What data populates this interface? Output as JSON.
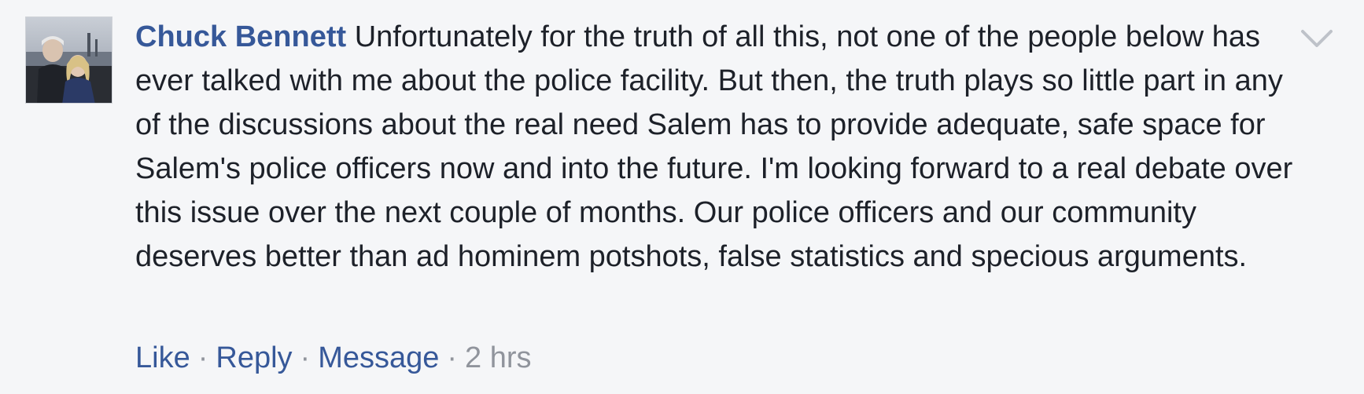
{
  "comment": {
    "author": "Chuck Bennett",
    "text": "Unfortunately for the truth of all this, not one of the people below has ever talked with me about the police facility. But then, the truth plays so little part in any of the discussions about the real need Salem has to provide adequate, safe space for Salem's police officers now and into the future. I'm looking forward to a real debate over this issue over the next couple of months. Our police officers and our community deserves better than ad hominem potshots, false statistics and specious arguments.",
    "actions": {
      "like": "Like",
      "reply": "Reply",
      "message": "Message",
      "separator": "·",
      "timestamp": "2 hrs"
    },
    "menu_icon": "chevron-down-icon"
  },
  "colors": {
    "background": "#f5f6f8",
    "link": "#365899",
    "text": "#1d2129",
    "muted": "#90949c"
  }
}
